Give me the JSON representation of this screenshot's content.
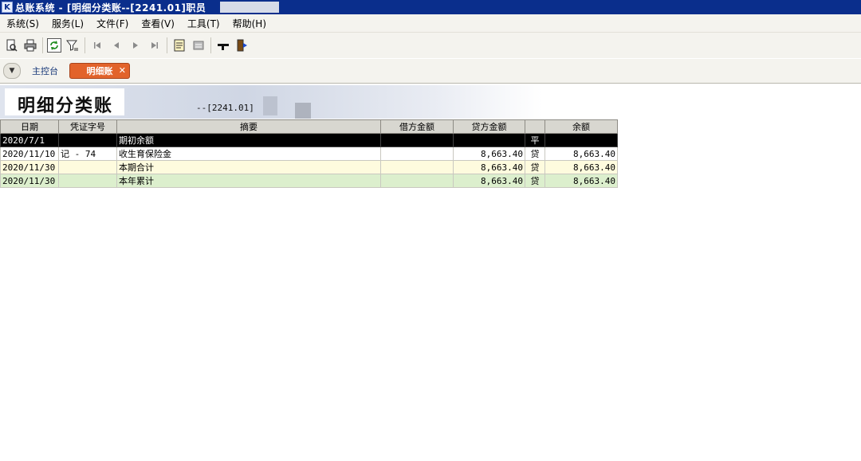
{
  "window": {
    "logo": "K",
    "title": "总账系统 - [明细分类账--[2241.01]职员"
  },
  "menu": {
    "items": [
      "系统(S)",
      "服务(L)",
      "文件(F)",
      "查看(V)",
      "工具(T)",
      "帮助(H)"
    ]
  },
  "toolbar": {
    "icons": [
      "print-preview-icon",
      "print-icon",
      "refresh-icon",
      "filter-icon",
      "first-record-icon",
      "prev-record-icon",
      "next-record-icon",
      "last-record-icon",
      "voucher-icon",
      "list-icon",
      "help-icon",
      "exit-icon"
    ]
  },
  "tabs": {
    "home_label": "主控台",
    "active_label": "明细账",
    "close_glyph": "✕"
  },
  "report": {
    "title": "明细分类账",
    "subtitle": "--[2241.01]"
  },
  "table": {
    "headers": [
      "日期",
      "凭证字号",
      "摘要",
      "借方金额",
      "贷方金额",
      "",
      "余额"
    ],
    "rows": [
      {
        "date": "2020/7/1",
        "voucher": "",
        "summary": "期初余额",
        "debit": "",
        "credit": "",
        "direction": "平",
        "balance": ""
      },
      {
        "date": "2020/11/10",
        "voucher": "记 - 74",
        "summary": "收生育保险金",
        "debit": "",
        "credit": "8,663.40",
        "direction": "贷",
        "balance": "8,663.40"
      },
      {
        "date": "2020/11/30",
        "voucher": "",
        "summary": "本期合计",
        "debit": "",
        "credit": "8,663.40",
        "direction": "贷",
        "balance": "8,663.40"
      },
      {
        "date": "2020/11/30",
        "voucher": "",
        "summary": "本年累计",
        "debit": "",
        "credit": "8,663.40",
        "direction": "贷",
        "balance": "8,663.40"
      }
    ]
  },
  "colors": {
    "titlebar": "#0a2e8c",
    "active_tab": "#e2632b",
    "period_row": "#fefbde",
    "year_row": "#dcefcd"
  }
}
